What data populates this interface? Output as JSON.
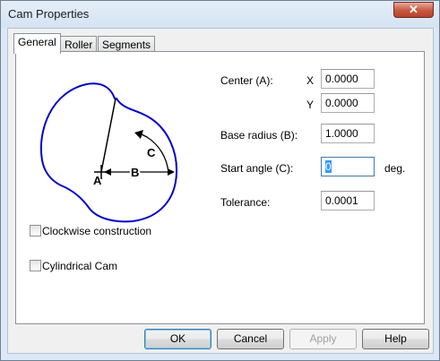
{
  "window": {
    "title": "Cam Properties",
    "close_glyph": "✕"
  },
  "tabs": [
    {
      "label": "General",
      "active": true
    },
    {
      "label": "Roller",
      "active": false
    },
    {
      "label": "Segments",
      "active": false
    }
  ],
  "diagram": {
    "label_a": "A",
    "label_b": "B",
    "label_c": "C",
    "cam_color": "#0000cc"
  },
  "form": {
    "center_label": "Center (A):",
    "x_label": "X",
    "x_value": "0.0000",
    "y_label": "Y",
    "y_value": "0.0000",
    "base_radius_label": "Base radius (B):",
    "base_radius_value": "1.0000",
    "start_angle_label": "Start angle (C):",
    "start_angle_value": "0",
    "start_angle_unit": "deg.",
    "tolerance_label": "Tolerance:",
    "tolerance_value": "0.0001"
  },
  "options": {
    "clockwise_label": "Clockwise construction",
    "clockwise_checked": false,
    "cylindrical_label": "Cylindrical Cam",
    "cylindrical_checked": false
  },
  "buttons": {
    "ok": "OK",
    "cancel": "Cancel",
    "apply": "Apply",
    "help": "Help"
  }
}
